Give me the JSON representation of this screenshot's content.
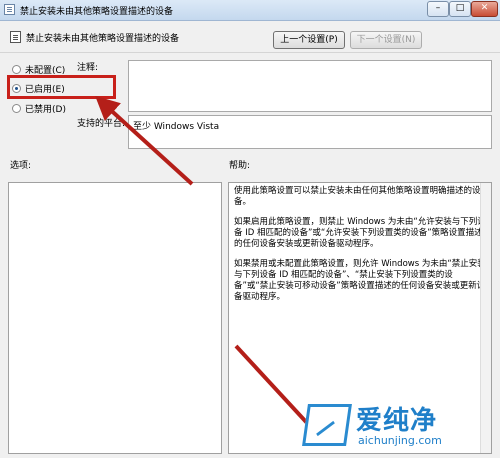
{
  "window": {
    "title": "禁止安装未由其他策略设置描述的设备",
    "controls": {
      "minimize": "–",
      "maximize": "□",
      "close": "✕"
    }
  },
  "header": {
    "title": "禁止安装未由其他策略设置描述的设备",
    "prev_label": "上一个设置(P)",
    "next_label": "下一个设置(N)"
  },
  "radios": [
    {
      "label": "未配置(C)",
      "checked": false
    },
    {
      "label": "已启用(E)",
      "checked": true
    },
    {
      "label": "已禁用(D)",
      "checked": false
    }
  ],
  "comment": {
    "label": "注释:",
    "value": ""
  },
  "support": {
    "label": "支持的平台:",
    "value": "至少 Windows Vista"
  },
  "options": {
    "label": "选项:"
  },
  "help": {
    "label": "帮助:",
    "paragraphs": [
      "使用此策略设置可以禁止安装未由任何其他策略设置明确描述的设备。",
      "如果启用此策略设置，则禁止 Windows 为未由“允许安装与下列设备 ID 相匹配的设备”或“允许安装下列设置类的设备”策略设置描述的任何设备安装或更新设备驱动程序。",
      "如果禁用或未配置此策略设置，则允许 Windows 为未由“禁止安装与下列设备 ID 相匹配的设备”、“禁止安装下列设置类的设备”或“禁止安装可移动设备”策略设置描述的任何设备安装或更新设备驱动程序。"
    ]
  },
  "watermark": {
    "cn": "爱纯净",
    "en": "aichunjing.com"
  },
  "colors": {
    "highlight": "#c8201a",
    "watermark": "#1f7fc9"
  }
}
